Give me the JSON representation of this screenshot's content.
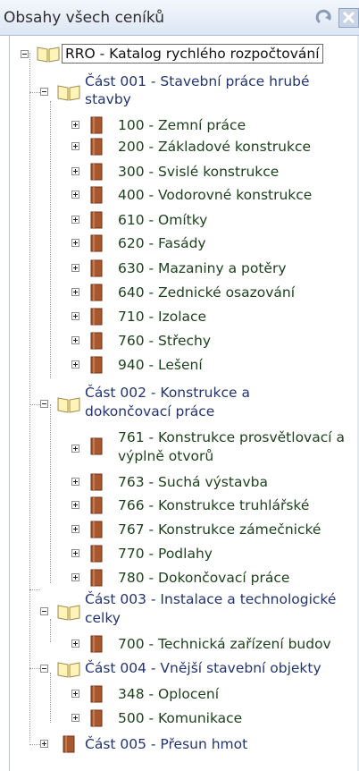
{
  "panel": {
    "title": "Obsahy všech ceníků",
    "buttons": {
      "refresh_icon": "refresh-icon",
      "close_icon": "close-icon"
    }
  },
  "tree": {
    "root_label": "RRO - Katalog rychlého rozpočtování",
    "sections": [
      {
        "label_line1": "Část 001 - Stavební práce hrubé",
        "label_line2": "stavby",
        "items": [
          "100 - Zemní práce",
          "200 - Základové konstrukce",
          "300 - Svislé konstrukce",
          "400 - Vodorovné konstrukce",
          "610 - Omítky",
          "620 - Fasády",
          "630 - Mazaniny a potěry",
          "640 - Zednické osazování",
          "710 - Izolace",
          "760 - Střechy",
          "940 - Lešení"
        ]
      },
      {
        "label_line1": "Část 002 - Konstrukce a",
        "label_line2": "dokončovací práce",
        "items": [
          "761 - Konstrukce prosvětlovací a",
          "výplně otvorů",
          "763 - Suchá výstavba",
          "766 - Konstrukce truhlářské",
          "767 - Konstrukce zámečnické",
          "770 - Podlahy",
          "780 - Dokončovací práce"
        ]
      },
      {
        "label_line1": "Část 003 - Instalace a technologické",
        "label_line2": "celky",
        "items": [
          "700 - Technická zařízení budov"
        ]
      },
      {
        "label_line1": "Část 004 - Vnější stavební objekty",
        "items": [
          "348 - Oplocení",
          "500 - Komunikace"
        ]
      },
      {
        "label_line1": "Část 005 - Přesun hmot"
      }
    ]
  },
  "colors": {
    "item_text": "#1c3f1c",
    "section_text": "#23346f",
    "binder_fill": "#a8582f",
    "book_fill": "#fff4b8"
  }
}
